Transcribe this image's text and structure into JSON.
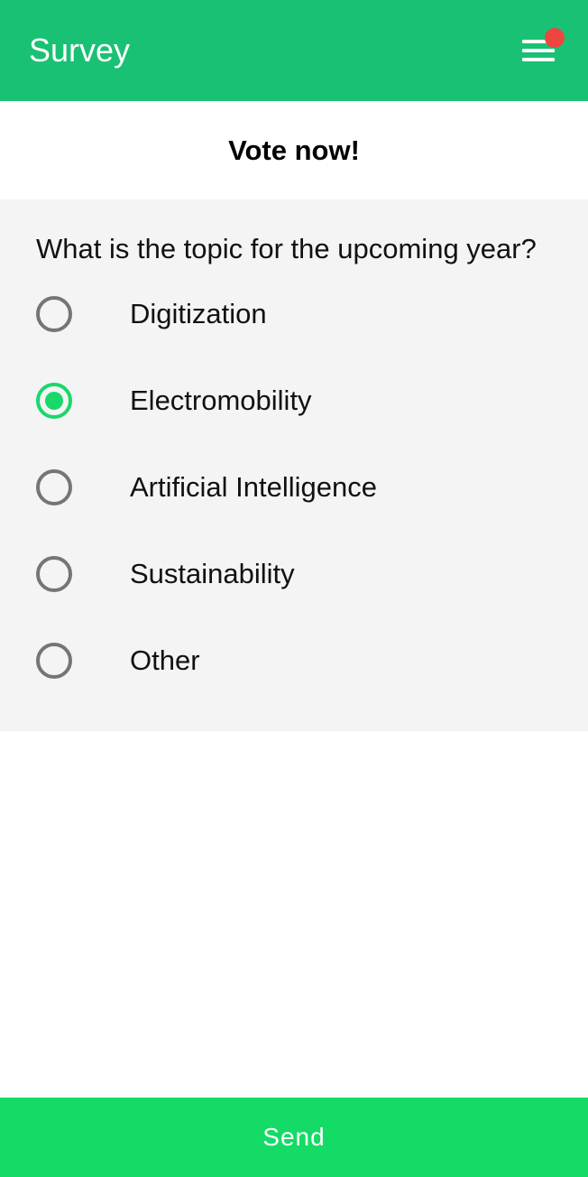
{
  "header": {
    "title": "Survey",
    "menu_icon": "hamburger-menu-icon",
    "notification_indicator": "notification-dot",
    "background_color": "#19c174",
    "notification_color": "#ee4541"
  },
  "subheader": {
    "title": "Vote now!"
  },
  "question": {
    "text": "What is the topic for the upcoming year?",
    "options": [
      {
        "label": "Digitization",
        "selected": false
      },
      {
        "label": "Electromobility",
        "selected": true
      },
      {
        "label": "Artificial Intelligence",
        "selected": false
      },
      {
        "label": "Sustainability",
        "selected": false
      },
      {
        "label": "Other",
        "selected": false
      }
    ],
    "selected_color": "#19d86a",
    "unselected_color": "#757575"
  },
  "footer": {
    "send_label": "Send",
    "button_color": "#14db66"
  }
}
